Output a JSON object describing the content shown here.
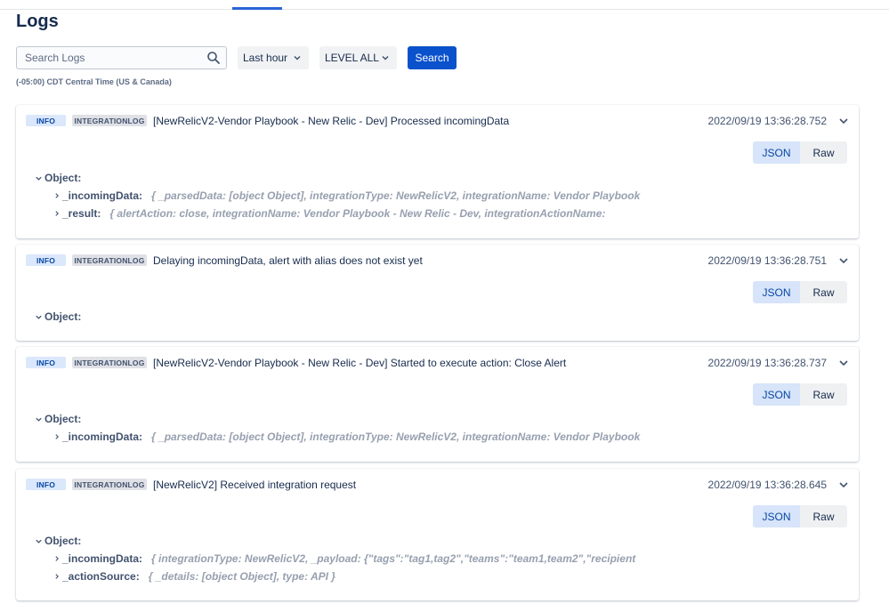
{
  "header": {
    "title": "Logs"
  },
  "filters": {
    "search_placeholder": "Search Logs",
    "time_range": "Last hour",
    "level": "LEVEL ALL",
    "search_button": "Search",
    "timezone_note": "(-05:00) CDT Central Time (US & Canada)"
  },
  "view_toggle": {
    "json_label": "JSON",
    "raw_label": "Raw",
    "selected": "JSON"
  },
  "object_label": "Object:",
  "logs": [
    {
      "level": "INFO",
      "type": "INTEGRATIONLOG",
      "message": "[NewRelicV2-Vendor Playbook - New Relic - Dev] Processed incomingData",
      "timestamp": "2022/09/19 13:36:28.752",
      "props": [
        {
          "key": "_incomingData:",
          "value": "{ _parsedData: [object Object], integrationType: NewRelicV2, integrationName: Vendor Playbook"
        },
        {
          "key": "_result:",
          "value": "{ alertAction: close, integrationName: Vendor Playbook - New Relic - Dev, integrationActionName:"
        }
      ]
    },
    {
      "level": "INFO",
      "type": "INTEGRATIONLOG",
      "message": "Delaying incomingData, alert with alias does not exist yet",
      "timestamp": "2022/09/19 13:36:28.751",
      "props": []
    },
    {
      "level": "INFO",
      "type": "INTEGRATIONLOG",
      "message": "[NewRelicV2-Vendor Playbook - New Relic - Dev] Started to execute action: Close Alert",
      "timestamp": "2022/09/19 13:36:28.737",
      "props": [
        {
          "key": "_incomingData:",
          "value": "{ _parsedData: [object Object], integrationType: NewRelicV2, integrationName: Vendor Playbook"
        }
      ]
    },
    {
      "level": "INFO",
      "type": "INTEGRATIONLOG",
      "message": "[NewRelicV2] Received integration request",
      "timestamp": "2022/09/19 13:36:28.645",
      "props": [
        {
          "key": "_incomingData:",
          "value": "{ integrationType: NewRelicV2, _payload: {\"tags\":\"tag1,tag2\",\"teams\":\"team1,team2\",\"recipient"
        },
        {
          "key": "_actionSource:",
          "value": "{ _details: [object Object], type: API }"
        }
      ]
    }
  ],
  "colors": {
    "accent": "#0a52cc",
    "badge_info_bg": "#dbe7fb",
    "badge_type_bg": "#dfe1e6",
    "toggle_selected_bg": "#d7e4f9"
  },
  "icons": {
    "search": "search-icon",
    "dropdown": "chevron-down-icon",
    "expand": "chevron-down-icon",
    "tree": "chevron-right-icon"
  }
}
